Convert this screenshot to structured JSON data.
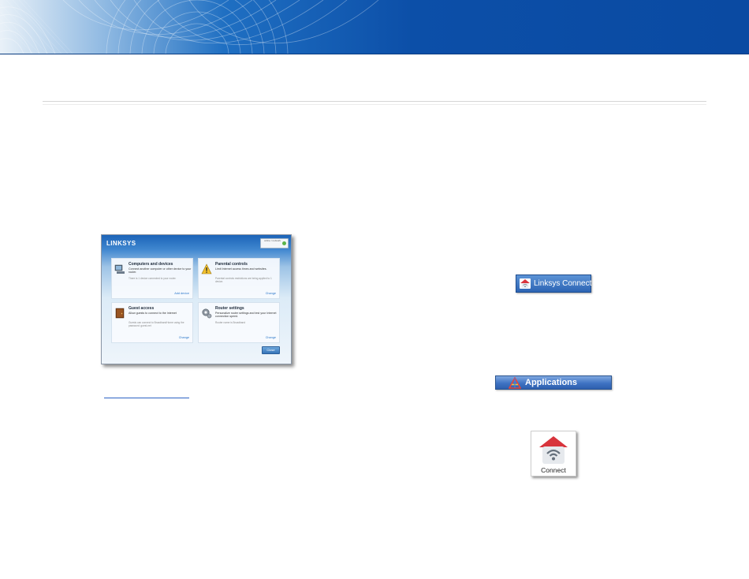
{
  "dashboard_screenshot": {
    "logo": "LINKSYS",
    "status_text": "online / network",
    "cards": [
      {
        "icon": "computer-icon",
        "title": "Computers and devices",
        "description": "Connect another computer or other device to your router.",
        "note": "There is 1 device connected to your router.",
        "link": "Add device"
      },
      {
        "icon": "warning-icon",
        "title": "Parental controls",
        "description": "Limit Internet access times and websites.",
        "note": "Parental controls restrictions are being applied to 1 device.",
        "link": "Change"
      },
      {
        "icon": "guest-door-icon",
        "title": "Guest access",
        "description": "Allow guests to connect to the Internet",
        "note": "Guests can connect to BroadbandHome using the password: guest-net",
        "link": "Change"
      },
      {
        "icon": "router-gear-icon",
        "title": "Router settings",
        "description": "Personalize router settings and test your Internet connection speed.",
        "note": "Router name is Broadband",
        "link": "Change"
      }
    ],
    "close_label": "Close"
  },
  "linksys_connect_button": {
    "icon": "linksys-home-wifi-icon",
    "label": "Linksys Connect"
  },
  "applications_bar": {
    "icon": "applications-folder-icon",
    "label": "Applications"
  },
  "connect_app_icon": {
    "icon": "home-wifi-app-icon",
    "label": "Connect"
  },
  "colors": {
    "banner_blue": "#0c4fa8",
    "link_blue": "#2b63c4",
    "button_blue": "#2c64b4",
    "house_red": "#d8343c"
  }
}
